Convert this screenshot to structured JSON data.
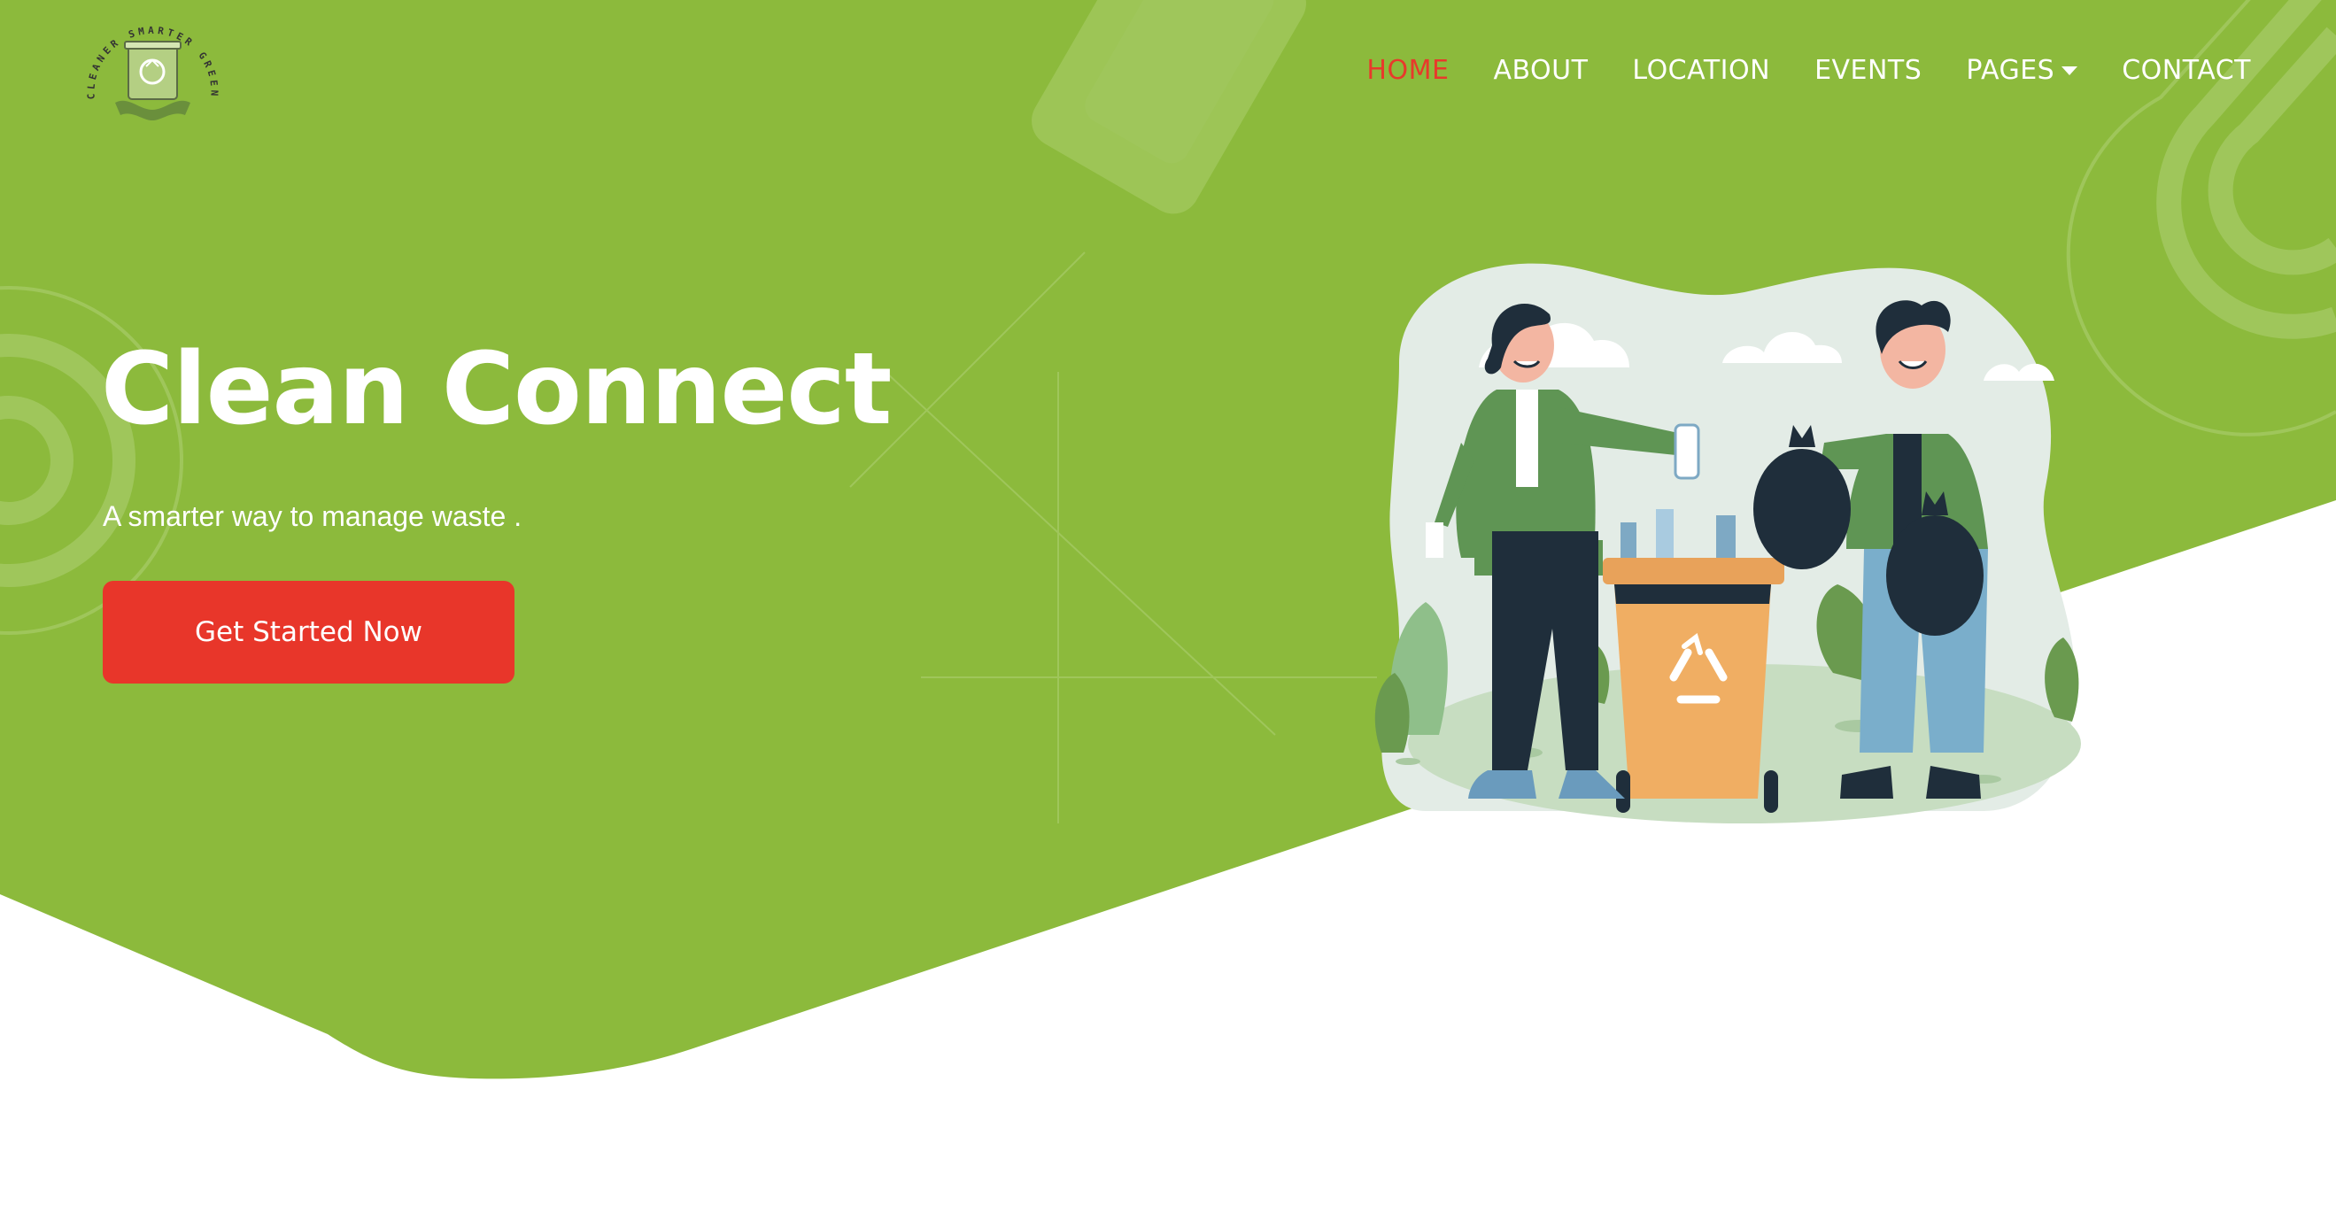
{
  "brand": {
    "logo_ring_text": "CLEANER SMARTER GREENER"
  },
  "nav": {
    "items": [
      {
        "label": "HOME",
        "active": true
      },
      {
        "label": "ABOUT",
        "active": false
      },
      {
        "label": "LOCATION",
        "active": false
      },
      {
        "label": "EVENTS",
        "active": false
      },
      {
        "label": "PAGES",
        "active": false,
        "has_dropdown": true
      },
      {
        "label": "CONTACT",
        "active": false
      }
    ]
  },
  "hero": {
    "title": "Clean Connect",
    "subtitle": "A smarter way to manage waste .",
    "cta_label": "Get Started Now"
  },
  "colors": {
    "brand_green": "#8cba3c",
    "accent_red": "#e8362a",
    "nav_active": "#e8392b",
    "text_light": "#ffffff"
  },
  "icons": {
    "logo": "recycle-bin-hands-icon",
    "nav_dropdown": "caret-down-icon",
    "bin_symbol": "recycle-icon"
  }
}
